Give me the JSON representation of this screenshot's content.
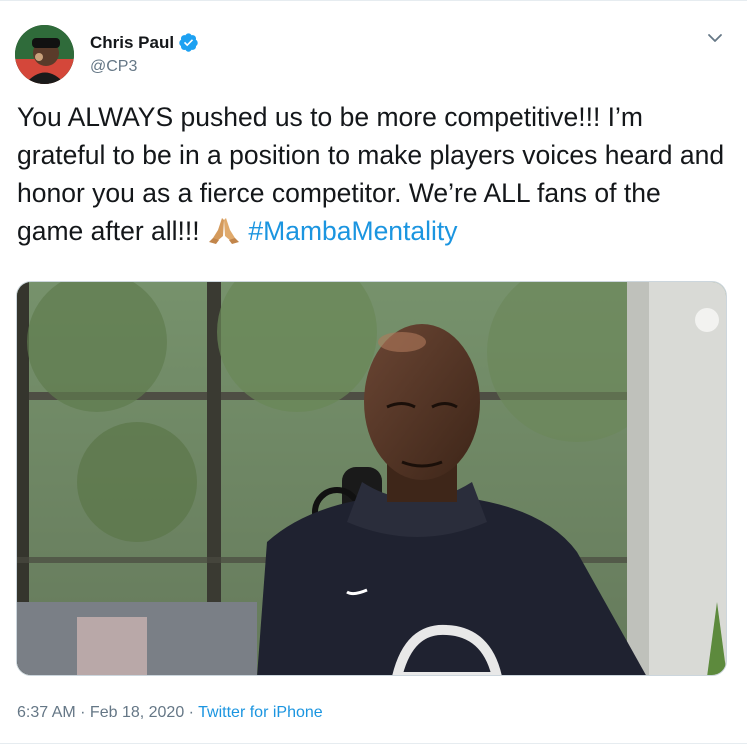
{
  "author": {
    "name": "Chris Paul",
    "handle": "@CP3",
    "avatar_icon": "profile-photo",
    "verified_icon": "verified-badge-icon"
  },
  "tweet": {
    "text_part1": "You ALWAYS pushed us to be more competitive!!! I’m grateful to be in a position to make players voices heard and honor you as a fierce competitor. We’re ALL fans of the game after all!!! ",
    "emoji_icon": "folded-hands-emoji",
    "hashtag": "#MambaMentality"
  },
  "media": {
    "type": "video",
    "description_icon": "video-thumbnail"
  },
  "footer": {
    "time": "6:37 AM",
    "separator1": " · ",
    "date": "Feb 18, 2020",
    "separator2": " · ",
    "source": "Twitter for iPhone"
  },
  "colors": {
    "accent": "#1b95e0",
    "text": "#14171a",
    "secondary": "#657786"
  }
}
